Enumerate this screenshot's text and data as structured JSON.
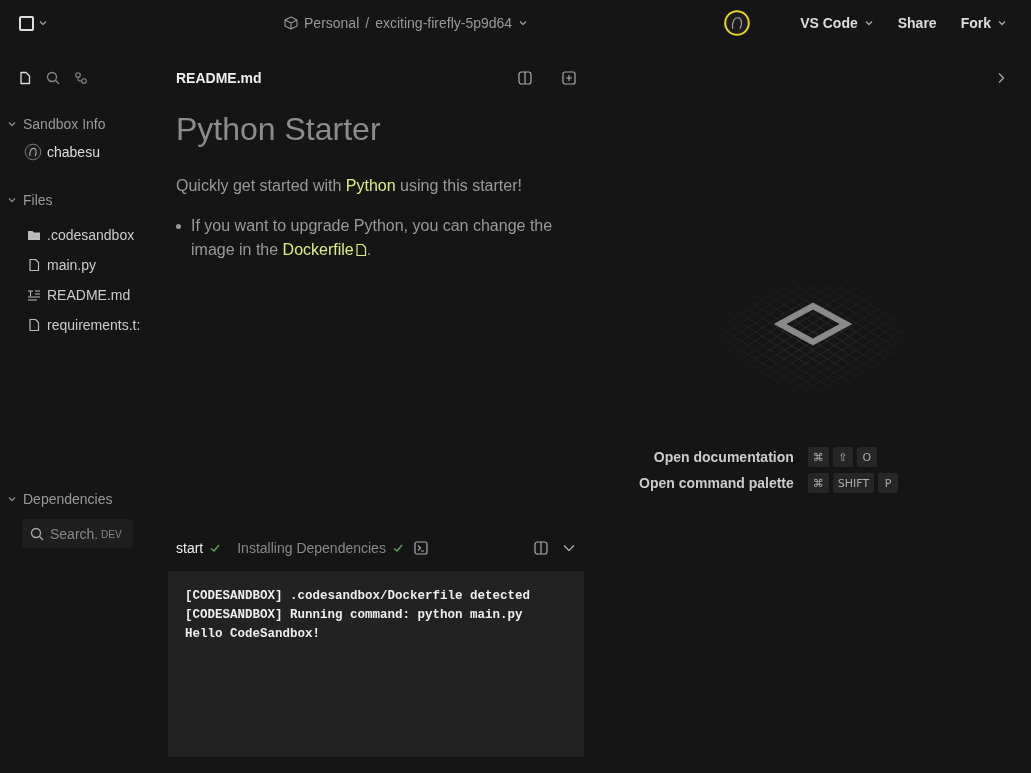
{
  "top_bar": {
    "breadcrumb": {
      "workspace": "Personal",
      "separator": "/",
      "sandbox": "exciting-firefly-5p9d64"
    },
    "buttons": [
      {
        "label": "VS Code",
        "dropdown": true
      },
      {
        "label": "Share",
        "dropdown": false
      },
      {
        "label": "Fork",
        "dropdown": true
      }
    ]
  },
  "sidebar": {
    "tools": [
      {
        "kind": "files",
        "selected": true
      },
      {
        "kind": "search",
        "selected": false
      },
      {
        "kind": "git",
        "selected": false
      }
    ],
    "sections": [
      {
        "kind": "info",
        "title": "Sandbox Info",
        "expanded": true,
        "user": "chabesu"
      },
      {
        "kind": "files",
        "title": "Files",
        "expanded": true,
        "items": [
          {
            "name": ".codesandbox",
            "kind": "folder"
          },
          {
            "name": "main.py",
            "kind": "file"
          },
          {
            "name": "README.md",
            "kind": "markdown"
          },
          {
            "name": "requirements.t:",
            "kind": "file"
          }
        ]
      },
      {
        "kind": "deps",
        "title": "Dependencies",
        "expanded": true,
        "search": {
          "placeholder": "Search.",
          "suffix": "DEV"
        }
      }
    ]
  },
  "editor": {
    "tab": "README.md",
    "heading": "Python Starter",
    "intro": {
      "before": "Quickly get started with ",
      "link": "Python",
      "after": " using this starter!"
    },
    "bullets": [
      {
        "before": "If you want to upgrade Python, you can change the image in the ",
        "link": "Dockerfile",
        "after": "."
      }
    ]
  },
  "terminal": {
    "tabs": [
      {
        "label": "start",
        "selected": true,
        "done": true
      },
      {
        "label": "Installing Dependencies",
        "selected": false,
        "done": true
      }
    ],
    "lines": [
      "[CODESANDBOX] .codesandbox/Dockerfile detected",
      "[CODESANDBOX] Running command: python main.py",
      "Hello CodeSandbox!"
    ]
  },
  "welcome": {
    "shortcuts": [
      {
        "label": "Open documentation",
        "keys": [
          "⌘",
          "⇧",
          "O"
        ]
      },
      {
        "label": "Open command palette",
        "keys": [
          "⌘",
          "SHIFT",
          "P"
        ]
      }
    ]
  }
}
